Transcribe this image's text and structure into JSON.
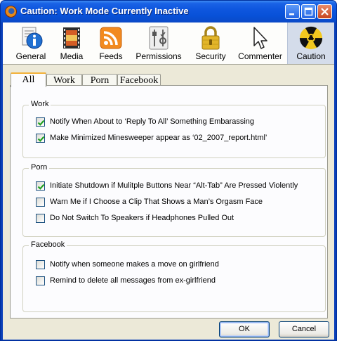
{
  "window": {
    "title": "Caution: Work Mode Currently Inactive"
  },
  "toolbar": {
    "items": [
      {
        "label": "General",
        "icon": "info-icon"
      },
      {
        "label": "Media",
        "icon": "media-film-icon"
      },
      {
        "label": "Feeds",
        "icon": "rss-feed-icon"
      },
      {
        "label": "Permissions",
        "icon": "sliders-icon"
      },
      {
        "label": "Security",
        "icon": "padlock-icon"
      },
      {
        "label": "Commenter",
        "icon": "cursor-arrow-icon"
      },
      {
        "label": "Caution",
        "icon": "radiation-icon"
      }
    ],
    "selected": "Caution"
  },
  "tabs": [
    {
      "label": "All",
      "active": true
    },
    {
      "label": "Work",
      "active": false
    },
    {
      "label": "Porn",
      "active": false
    },
    {
      "label": "Facebook",
      "active": false
    }
  ],
  "groups": {
    "work": {
      "title": "Work",
      "options": [
        {
          "label": "Notify When About to ‘Reply To All’ Something Embarassing",
          "checked": true
        },
        {
          "label": "Make Minimized Minesweeper appear as ‘02_2007_report.html’",
          "checked": true
        }
      ]
    },
    "porn": {
      "title": "Porn",
      "options": [
        {
          "label": "Initiate Shutdown if Mulitple Buttons Near “Alt-Tab” Are Pressed Violently",
          "checked": true
        },
        {
          "label": "Warn Me if I Choose a Clip That Shows a Man’s Orgasm Face",
          "checked": false
        },
        {
          "label": "Do Not Switch To Speakers if Headphones Pulled Out",
          "checked": false
        }
      ]
    },
    "facebook": {
      "title": "Facebook",
      "options": [
        {
          "label": "Notify when someone makes a move on girlfriend",
          "checked": false
        },
        {
          "label": "Remind to delete all messages from ex-girlfriend",
          "checked": false
        }
      ]
    }
  },
  "buttons": {
    "ok": "OK",
    "cancel": "Cancel"
  },
  "colors": {
    "titlebar": "#0a53d6",
    "accent_tab": "#f3b13a",
    "check": "#21a121"
  }
}
